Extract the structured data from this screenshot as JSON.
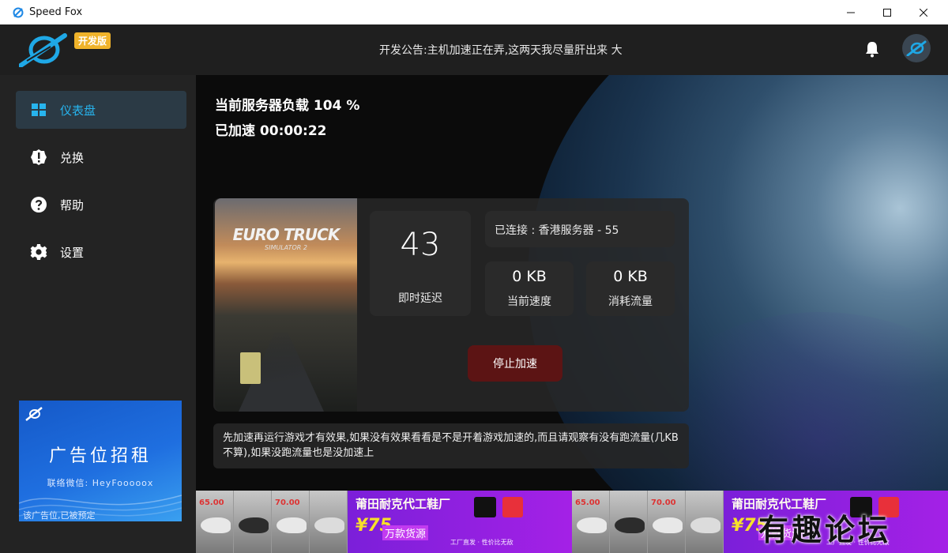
{
  "window": {
    "title": "Speed Fox"
  },
  "header": {
    "dev_badge": "开发版",
    "notice": "开发公告:主机加速正在弄,这两天我尽量肝出来   大"
  },
  "sidebar": {
    "items": [
      {
        "label": "仪表盘",
        "icon": "dashboard-icon",
        "active": true
      },
      {
        "label": "兑换",
        "icon": "badge-alert-icon",
        "active": false
      },
      {
        "label": "帮助",
        "icon": "help-icon",
        "active": false
      },
      {
        "label": "设置",
        "icon": "gear-icon",
        "active": false
      }
    ],
    "ad": {
      "title": "广告位招租",
      "contact": "联络微信: HeyFoooooх",
      "note": "该广告位,已被预定"
    }
  },
  "main": {
    "server_load": "当前服务器负载 104 %",
    "accelerated": "已加速 00:00:22",
    "game": {
      "title": "EURO TRUCK",
      "subtitle": "SIMULATOR 2"
    },
    "latency": {
      "value": "43",
      "label": "即时延迟"
    },
    "connected": "已连接 : 香港服务器 - 55",
    "speed": {
      "value": "0 KB",
      "label": "当前速度"
    },
    "traffic": {
      "value": "0 KB",
      "label": "消耗流量"
    },
    "stop_button": "停止加速",
    "tip": "先加速再运行游戏才有效果,如果没有效果看看是不是开着游戏加速的,而且请观察有没有跑流量(几KB不算),如果没跑流量也是没加速上"
  },
  "banner": {
    "shop": "莆田耐克代工鞋厂",
    "amount": "¥75",
    "goods": "万款货源",
    "slogan": "工厂直发 · 性价比无敌",
    "prices": [
      "65.00",
      "70.00",
      "65.00",
      "70.00"
    ]
  },
  "watermark": "有趣论坛",
  "colors": {
    "accent": "#27b4ee",
    "stop_button": "#5c1414",
    "dev_badge": "#f0b32a"
  }
}
